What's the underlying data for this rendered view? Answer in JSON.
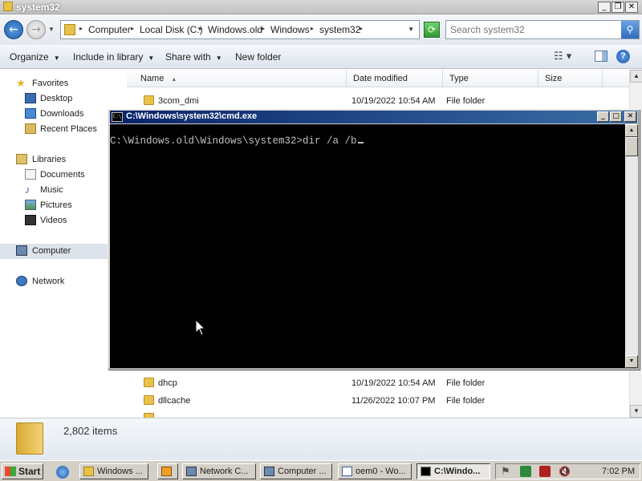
{
  "explorer": {
    "title": "system32",
    "breadcrumbs": [
      "Computer",
      "Local Disk (C:)",
      "Windows.old",
      "Windows",
      "system32"
    ],
    "search_placeholder": "Search system32",
    "toolbar": {
      "organize": "Organize",
      "include_in_library": "Include in library",
      "share_with": "Share with",
      "new_folder": "New folder"
    },
    "nav": {
      "favorites": "Favorites",
      "desktop": "Desktop",
      "downloads": "Downloads",
      "recent_places": "Recent Places",
      "libraries": "Libraries",
      "documents": "Documents",
      "music": "Music",
      "pictures": "Pictures",
      "videos": "Videos",
      "computer": "Computer",
      "network": "Network"
    },
    "columns": [
      "Name",
      "Date modified",
      "Type",
      "Size"
    ],
    "files": [
      {
        "name": "3com_dmi",
        "date": "10/19/2022 10:54 AM",
        "type": "File folder"
      },
      {
        "name": "dhcp",
        "date": "10/19/2022 10:54 AM",
        "type": "File folder"
      },
      {
        "name": "dllcache",
        "date": "11/26/2022 10:07 PM",
        "type": "File folder"
      }
    ],
    "item_count": "2,802 items"
  },
  "cmd": {
    "title": "C:\\Windows\\system32\\cmd.exe",
    "prompt_line": "C:\\Windows.old\\Windows\\system32>dir /a /b"
  },
  "taskbar": {
    "start": "Start",
    "tasks": [
      "Windows ...",
      "Network C...",
      "Computer ...",
      "oem0 - Wo...",
      "C:\\Windo..."
    ],
    "clock": "7:02 PM"
  },
  "colors": {
    "cmd_title_start": "#0a246a",
    "cmd_title_end": "#3a6ea5",
    "console_bg": "#000000",
    "console_fg": "#c0c0c0",
    "taskbar_bg": "#d4d0c8"
  }
}
